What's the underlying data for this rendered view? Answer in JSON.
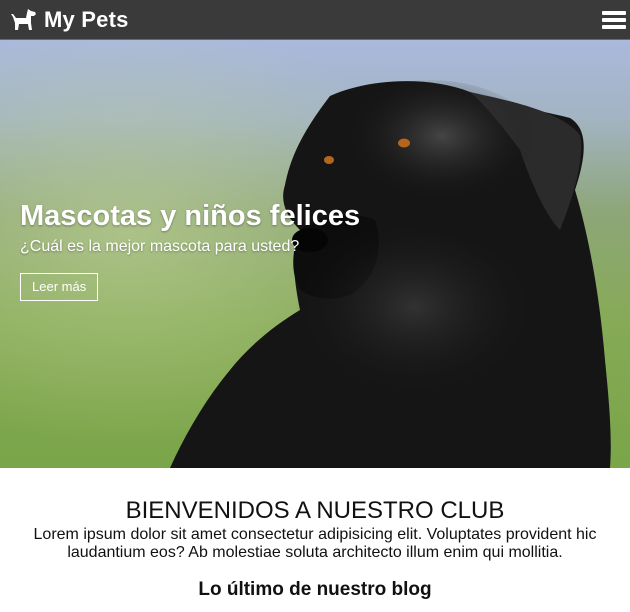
{
  "navbar": {
    "brand_label": "My Pets",
    "brand_icon": "dog-icon",
    "menu_icon": "hamburger-icon",
    "background": "#3a3a3a"
  },
  "hero": {
    "title": "Mascotas y niños felices",
    "subtitle": "¿Cuál es la mejor mascota para usted?",
    "button_label": "Leer más",
    "image": "black-labrador-dog-photo"
  },
  "welcome": {
    "heading": "BIENVENIDOS A NUESTRO CLUB",
    "body": "Lorem ipsum dolor sit amet consectetur adipisicing elit. Voluptates provident hic laudantium eos? Ab molestiae soluta architecto illum enim qui mollitia.",
    "blog_heading": "Lo último de nuestro blog"
  }
}
